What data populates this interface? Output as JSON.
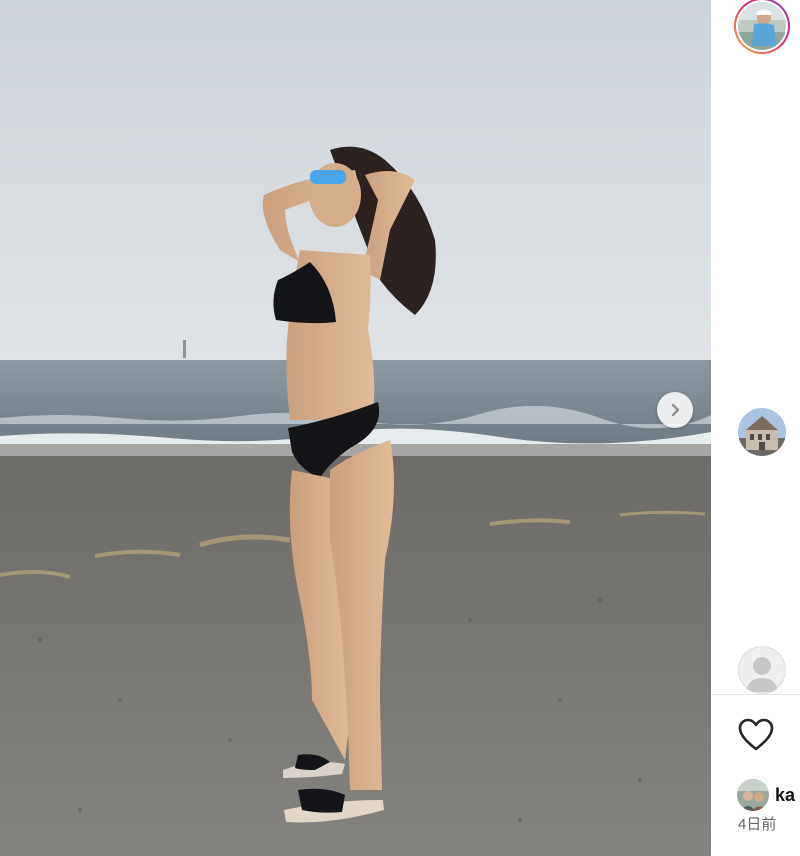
{
  "post": {
    "photo_alt": "beach photo",
    "next_label": "›"
  },
  "comment": {
    "username": "ka",
    "time": "4日前"
  },
  "colors": {
    "story_ring": "#e1306c",
    "like_outline": "#262626"
  },
  "icons": [
    "chevron-right-icon",
    "heart-icon",
    "user-icon"
  ]
}
